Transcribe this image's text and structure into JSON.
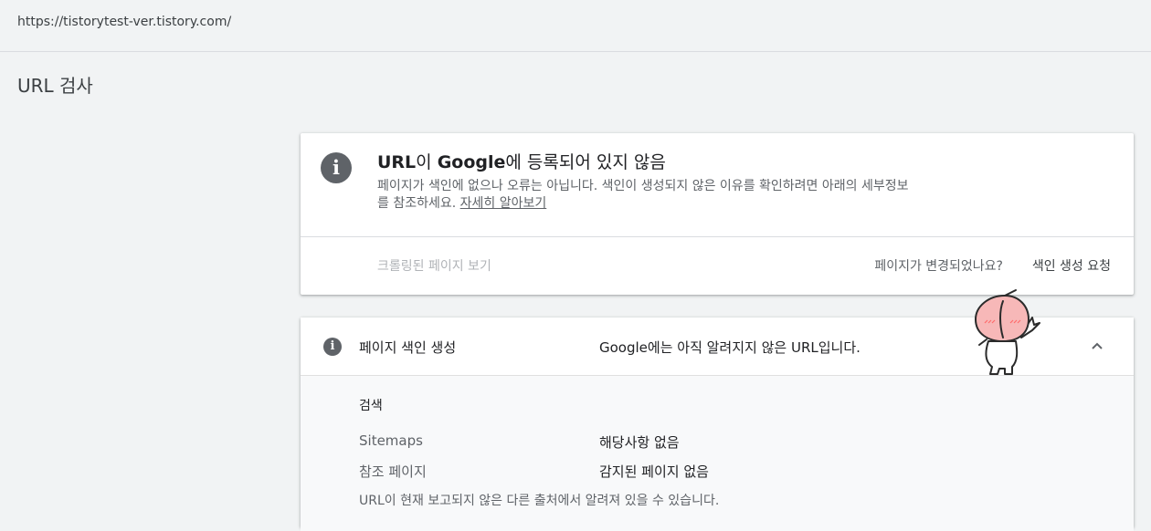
{
  "header": {
    "property_url": "https://tistorytest-ver.tistory.com/"
  },
  "page": {
    "title": "URL 검사"
  },
  "status_card": {
    "title_part1": "URL",
    "title_part2": "이 ",
    "title_part3": "Google",
    "title_part4": "에 등록되어 있지 않음",
    "description": "페이지가 색인에 없으나 오류는 아닙니다. 색인이 생성되지 않은 이유를 확인하려면 아래의 세부정보를 참조하세요. ",
    "learn_more": "자세히 알아보기",
    "view_crawled": "크롤링된 페이지 보기",
    "page_changed": "페이지가 변경되었나요?",
    "request_indexing": "색인 생성 요청",
    "info_icon": "info-icon"
  },
  "coverage": {
    "label": "페이지 색인 생성",
    "value": "Google에는 아직 알려지지 않은 URL입니다.",
    "icon": "info-icon",
    "toggle_icon": "chevron-up-icon",
    "section_title": "검색",
    "rows": [
      {
        "label": "Sitemaps",
        "value": "해당사항 없음"
      },
      {
        "label": "참조 페이지",
        "value": "감지된 페이지 없음"
      }
    ],
    "note": "URL이 현재 보고되지 않은 다른 출처에서 알려져 있을 수 있습니다."
  },
  "colors": {
    "background": "#f1f3f4",
    "card": "#ffffff",
    "icon": "#5f6368",
    "mascot": "#f7b8b8"
  }
}
